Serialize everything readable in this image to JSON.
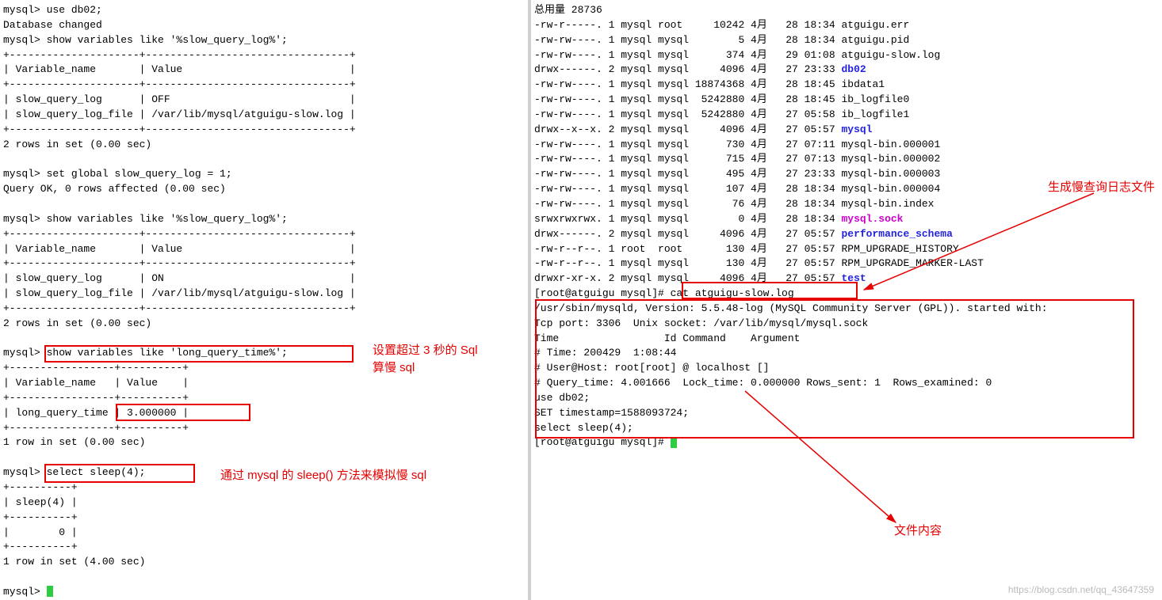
{
  "left": {
    "lines": [
      "mysql> use db02;",
      "Database changed",
      "mysql> show variables like '%slow_query_log%';",
      "+---------------------+---------------------------------+",
      "| Variable_name       | Value                           |",
      "+---------------------+---------------------------------+",
      "| slow_query_log      | OFF                             |",
      "| slow_query_log_file | /var/lib/mysql/atguigu-slow.log |",
      "+---------------------+---------------------------------+",
      "2 rows in set (0.00 sec)",
      "",
      "mysql> set global slow_query_log = 1;",
      "Query OK, 0 rows affected (0.00 sec)",
      "",
      "mysql> show variables like '%slow_query_log%';",
      "+---------------------+---------------------------------+",
      "| Variable_name       | Value                           |",
      "+---------------------+---------------------------------+",
      "| slow_query_log      | ON                              |",
      "| slow_query_log_file | /var/lib/mysql/atguigu-slow.log |",
      "+---------------------+---------------------------------+",
      "2 rows in set (0.00 sec)",
      "",
      "mysql> show variables like 'long_query_time%';",
      "+-----------------+----------+",
      "| Variable_name   | Value    |",
      "+-----------------+----------+",
      "| long_query_time | 3.000000 |",
      "+-----------------+----------+",
      "1 row in set (0.00 sec)",
      "",
      "mysql> select sleep(4);",
      "+----------+",
      "| sleep(4) |",
      "+----------+",
      "|        0 |",
      "+----------+",
      "1 row in set (4.00 sec)",
      "",
      "mysql> "
    ]
  },
  "right": {
    "total": "总用量 28736",
    "ls": [
      {
        "perm": "-rw-r-----.",
        "n": "1",
        "u": "mysql",
        "g": "root ",
        "sz": "   10242",
        "mo": "4月",
        "d": " 28",
        "t": "18:34",
        "name": "atguigu.err",
        "cls": ""
      },
      {
        "perm": "-rw-rw----.",
        "n": "1",
        "u": "mysql",
        "g": "mysql",
        "sz": "       5",
        "mo": "4月",
        "d": " 28",
        "t": "18:34",
        "name": "atguigu.pid",
        "cls": ""
      },
      {
        "perm": "-rw-rw----.",
        "n": "1",
        "u": "mysql",
        "g": "mysql",
        "sz": "     374",
        "mo": "4月",
        "d": " 29",
        "t": "01:08",
        "name": "atguigu-slow.log",
        "cls": ""
      },
      {
        "perm": "drwx------.",
        "n": "2",
        "u": "mysql",
        "g": "mysql",
        "sz": "    4096",
        "mo": "4月",
        "d": " 27",
        "t": "23:33",
        "name": "db02",
        "cls": "blue"
      },
      {
        "perm": "-rw-rw----.",
        "n": "1",
        "u": "mysql",
        "g": "mysql",
        "sz": "18874368",
        "mo": "4月",
        "d": " 28",
        "t": "18:45",
        "name": "ibdata1",
        "cls": ""
      },
      {
        "perm": "-rw-rw----.",
        "n": "1",
        "u": "mysql",
        "g": "mysql",
        "sz": " 5242880",
        "mo": "4月",
        "d": " 28",
        "t": "18:45",
        "name": "ib_logfile0",
        "cls": ""
      },
      {
        "perm": "-rw-rw----.",
        "n": "1",
        "u": "mysql",
        "g": "mysql",
        "sz": " 5242880",
        "mo": "4月",
        "d": " 27",
        "t": "05:58",
        "name": "ib_logfile1",
        "cls": ""
      },
      {
        "perm": "drwx--x--x.",
        "n": "2",
        "u": "mysql",
        "g": "mysql",
        "sz": "    4096",
        "mo": "4月",
        "d": " 27",
        "t": "05:57",
        "name": "mysql",
        "cls": "blue"
      },
      {
        "perm": "-rw-rw----.",
        "n": "1",
        "u": "mysql",
        "g": "mysql",
        "sz": "     730",
        "mo": "4月",
        "d": " 27",
        "t": "07:11",
        "name": "mysql-bin.000001",
        "cls": ""
      },
      {
        "perm": "-rw-rw----.",
        "n": "1",
        "u": "mysql",
        "g": "mysql",
        "sz": "     715",
        "mo": "4月",
        "d": " 27",
        "t": "07:13",
        "name": "mysql-bin.000002",
        "cls": ""
      },
      {
        "perm": "-rw-rw----.",
        "n": "1",
        "u": "mysql",
        "g": "mysql",
        "sz": "     495",
        "mo": "4月",
        "d": " 27",
        "t": "23:33",
        "name": "mysql-bin.000003",
        "cls": ""
      },
      {
        "perm": "-rw-rw----.",
        "n": "1",
        "u": "mysql",
        "g": "mysql",
        "sz": "     107",
        "mo": "4月",
        "d": " 28",
        "t": "18:34",
        "name": "mysql-bin.000004",
        "cls": ""
      },
      {
        "perm": "-rw-rw----.",
        "n": "1",
        "u": "mysql",
        "g": "mysql",
        "sz": "      76",
        "mo": "4月",
        "d": " 28",
        "t": "18:34",
        "name": "mysql-bin.index",
        "cls": ""
      },
      {
        "perm": "srwxrwxrwx.",
        "n": "1",
        "u": "mysql",
        "g": "mysql",
        "sz": "       0",
        "mo": "4月",
        "d": " 28",
        "t": "18:34",
        "name": "mysql.sock",
        "cls": "mag"
      },
      {
        "perm": "drwx------.",
        "n": "2",
        "u": "mysql",
        "g": "mysql",
        "sz": "    4096",
        "mo": "4月",
        "d": " 27",
        "t": "05:57",
        "name": "performance_schema",
        "cls": "blue"
      },
      {
        "perm": "-rw-r--r--.",
        "n": "1",
        "u": "root ",
        "g": "root ",
        "sz": "     130",
        "mo": "4月",
        "d": " 27",
        "t": "05:57",
        "name": "RPM_UPGRADE_HISTORY",
        "cls": ""
      },
      {
        "perm": "-rw-r--r--.",
        "n": "1",
        "u": "mysql",
        "g": "mysql",
        "sz": "     130",
        "mo": "4月",
        "d": " 27",
        "t": "05:57",
        "name": "RPM_UPGRADE_MARKER-LAST",
        "cls": ""
      },
      {
        "perm": "drwxr-xr-x.",
        "n": "2",
        "u": "mysql",
        "g": "mysql",
        "sz": "    4096",
        "mo": "4月",
        "d": " 27",
        "t": "05:57",
        "name": "test",
        "cls": "blue"
      }
    ],
    "prompt1": "[root@atguigu mysql]# cat atguigu-slow.log",
    "slowlog": [
      "/usr/sbin/mysqld, Version: 5.5.48-log (MySQL Community Server (GPL)). started with:",
      "Tcp port: 3306  Unix socket: /var/lib/mysql/mysql.sock",
      "Time                 Id Command    Argument",
      "# Time: 200429  1:08:44",
      "# User@Host: root[root] @ localhost []",
      "# Query_time: 4.001666  Lock_time: 0.000000 Rows_sent: 1  Rows_examined: 0",
      "use db02;",
      "SET timestamp=1588093724;",
      "select sleep(4);"
    ],
    "prompt2": "[root@atguigu mysql]# "
  },
  "annotations": {
    "a1_line1": "设置超过 3 秒的 Sql",
    "a1_line2": "算慢 sql",
    "a2": "通过 mysql 的 sleep() 方法来模拟慢 sql",
    "a3": "生成慢查询日志文件",
    "a4": "文件内容"
  },
  "watermark": "https://blog.csdn.net/qq_43647359"
}
